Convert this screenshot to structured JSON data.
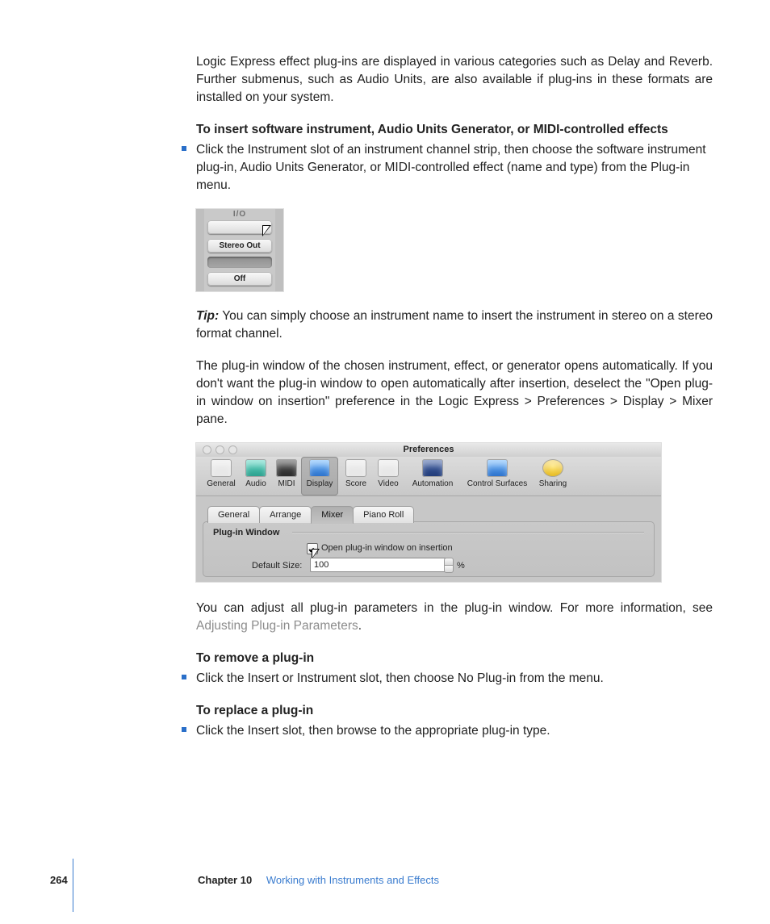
{
  "para1": "Logic Express effect plug-ins are displayed in various categories such as Delay and Reverb. Further submenus, such as Audio Units, are also available if plug-ins in these formats are installed on your system.",
  "heading_insert": "To insert software instrument, Audio Units Generator, or MIDI-controlled effects",
  "bullet_insert": "Click the Instrument slot of an instrument channel strip, then choose the software instrument plug-in, Audio Units Generator, or MIDI-controlled effect (name and type) from the Plug-in menu.",
  "io_strip": {
    "header": "I/O",
    "slot1": "",
    "slot2": "Stereo Out",
    "slot3": "",
    "slot4": "Off"
  },
  "tip_label": "Tip:",
  "tip_text": "  You can simply choose an instrument name to insert the instrument in stereo on a stereo format channel.",
  "para2": "The plug-in window of the chosen instrument, effect, or generator opens automatically. If you don't want the plug-in window to open automatically after insertion, deselect the \"Open plug-in window on insertion\" preference in the Logic Express > Preferences > Display > Mixer pane.",
  "prefs": {
    "title": "Preferences",
    "toolbar": [
      "General",
      "Audio",
      "MIDI",
      "Display",
      "Score",
      "Video",
      "Automation",
      "Control Surfaces",
      "Sharing"
    ],
    "subtabs": [
      "General",
      "Arrange",
      "Mixer",
      "Piano Roll"
    ],
    "group": "Plug-in Window",
    "checkbox": "Open plug-in window on insertion",
    "default_size_label": "Default Size:",
    "default_size_value": "100",
    "pct": "%"
  },
  "para3a": "You can adjust all plug-in parameters in the plug-in window. For more information, see ",
  "para3_link": "Adjusting Plug-in Parameters",
  "para3b": ".",
  "heading_remove": "To remove a plug-in",
  "bullet_remove": "Click the Insert or Instrument slot, then choose No Plug-in from the menu.",
  "heading_replace": "To replace a plug-in",
  "bullet_replace": "Click the Insert slot, then browse to the appropriate plug-in type.",
  "footer": {
    "page": "264",
    "chapter_label": "Chapter 10",
    "chapter_title": "Working with Instruments and Effects"
  }
}
